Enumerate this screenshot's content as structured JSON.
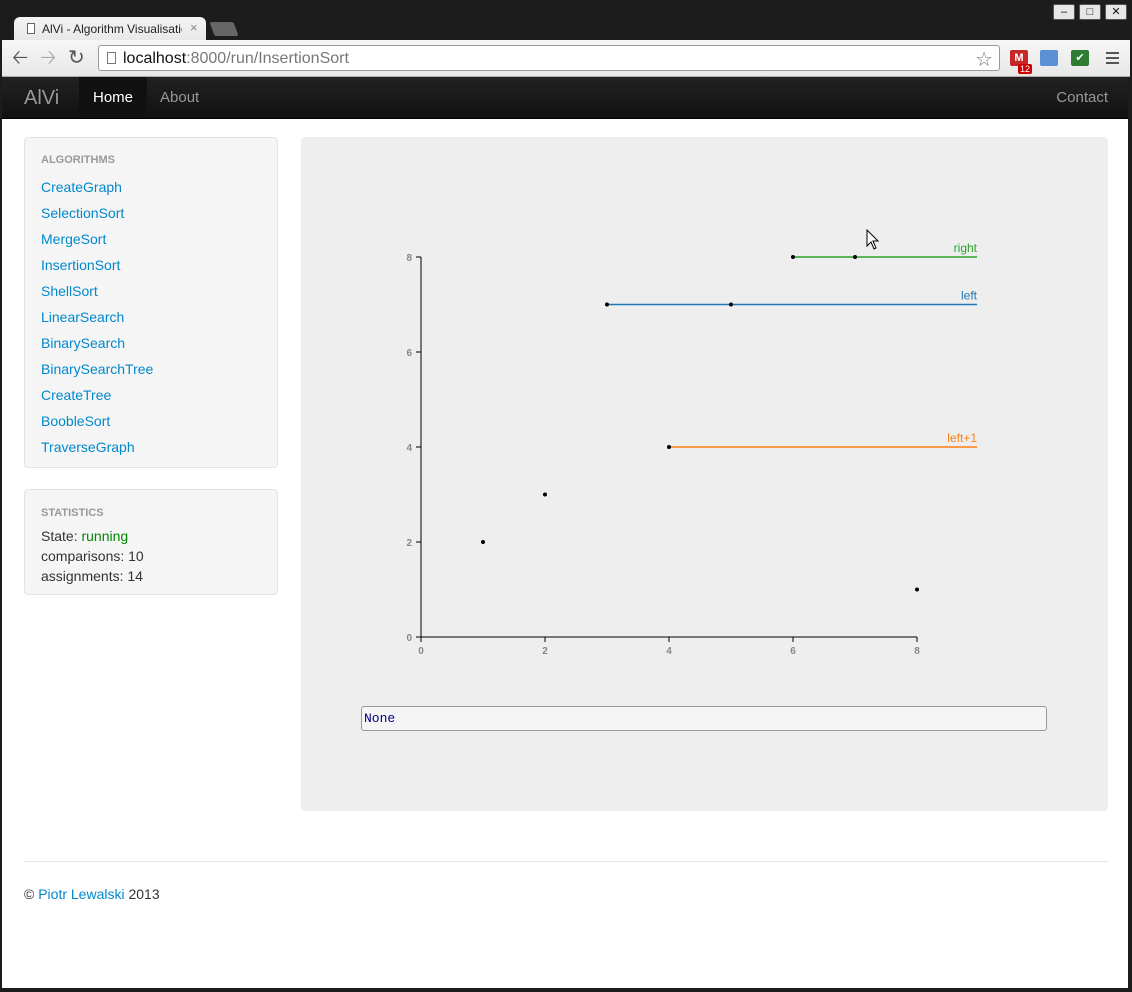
{
  "browser": {
    "tab_title": "AlVi - Algorithm Visualisatio",
    "tab_close": "×",
    "url_host": "localhost",
    "url_path": ":8000/run/InsertionSort",
    "ext_badge": "12",
    "window_buttons": [
      "–",
      "□",
      "✕"
    ]
  },
  "navbar": {
    "brand": "AlVi",
    "links": [
      "Home",
      "About"
    ],
    "contact": "Contact",
    "active": "Home"
  },
  "sidebar": {
    "algorithms_header": "ALGORITHMS",
    "algorithms": [
      "CreateGraph",
      "SelectionSort",
      "MergeSort",
      "InsertionSort",
      "ShellSort",
      "LinearSearch",
      "BinarySearch",
      "BinarySearchTree",
      "CreateTree",
      "BoobleSort",
      "TraverseGraph"
    ],
    "statistics_header": "STATISTICS",
    "state_label": "State:",
    "state_value": "running",
    "comparisons": "comparisons: 10",
    "assignments": "assignments: 14"
  },
  "visualization": {
    "output_text": "None",
    "chart_data": {
      "type": "scatter",
      "xlim": [
        0,
        8
      ],
      "ylim": [
        0,
        8
      ],
      "x_ticks": [
        0,
        2,
        4,
        6,
        8
      ],
      "y_ticks": [
        0,
        2,
        4,
        6,
        8
      ],
      "points": [
        {
          "x": 1,
          "y": 2
        },
        {
          "x": 2,
          "y": 3
        },
        {
          "x": 3,
          "y": 7
        },
        {
          "x": 4,
          "y": 4
        },
        {
          "x": 5,
          "y": 7
        },
        {
          "x": 6,
          "y": 8
        },
        {
          "x": 7,
          "y": 8
        },
        {
          "x": 8,
          "y": 1
        }
      ],
      "markers": [
        {
          "label": "right",
          "x_start": 6,
          "y": 8,
          "color": "#2ca02c"
        },
        {
          "label": "left",
          "x_start": 3,
          "y": 7,
          "color": "#1f77b4"
        },
        {
          "label": "left+1",
          "x_start": 4,
          "y": 4,
          "color": "#ff7f0e"
        }
      ]
    }
  },
  "footer": {
    "copyright": "©",
    "author": "Piotr Lewalski",
    "year": "2013"
  }
}
